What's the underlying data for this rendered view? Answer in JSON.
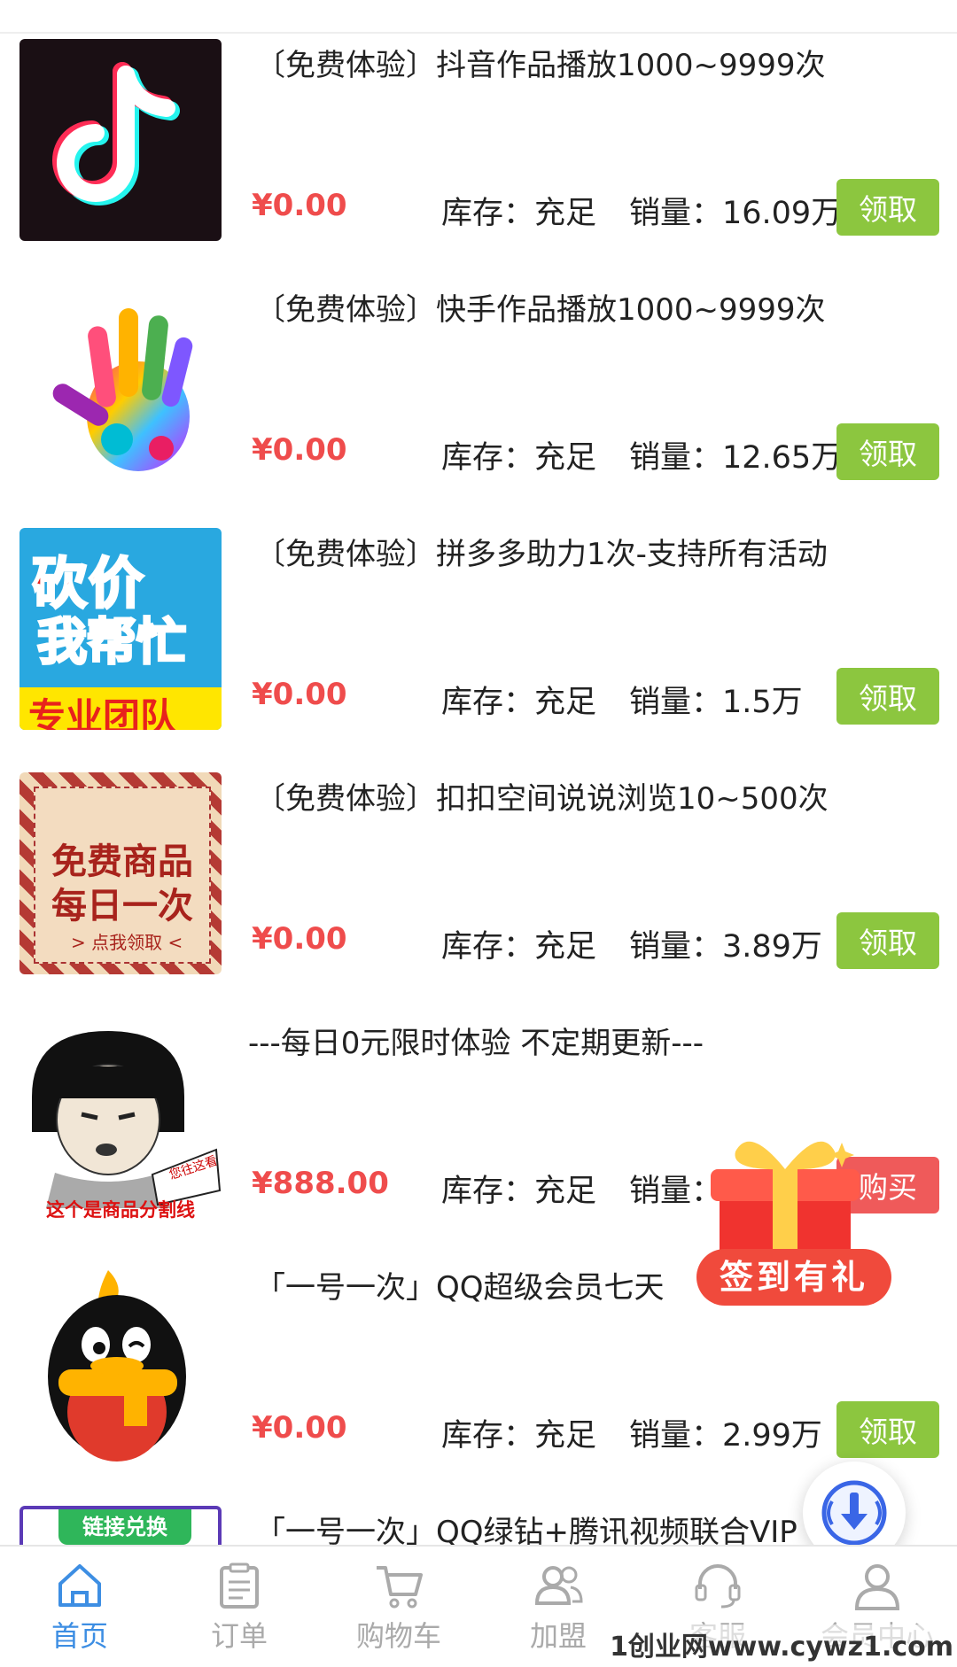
{
  "products": [
    {
      "title": "〔免费体验〕抖音作品播放1000~9999次",
      "price": "¥0.00",
      "stock": "库存：充足",
      "sales": "销量：16.09万",
      "button": "领取",
      "thumb": "douyin-logo"
    },
    {
      "title": "〔免费体验〕快手作品播放1000~9999次",
      "price": "¥0.00",
      "stock": "库存：充足",
      "sales": "销量：12.65万",
      "button": "领取",
      "thumb": "colorful-hand"
    },
    {
      "title": "〔免费体验〕拼多多助力1次-支持所有活动",
      "price": "¥0.00",
      "stock": "库存：充足",
      "sales": "销量：1.5万",
      "button": "领取",
      "thumb": "bargain-help"
    },
    {
      "title": "〔免费体验〕扣扣空间说说浏览10~500次",
      "price": "¥0.00",
      "stock": "库存：充足",
      "sales": "销量：3.89万",
      "button": "领取",
      "thumb": "free-product-daily"
    },
    {
      "title": "---每日0元限时体验 不定期更新---",
      "price": "¥888.00",
      "stock": "库存：充足",
      "sales": "销量：(",
      "button": "购买",
      "thumb": "meme-divider"
    },
    {
      "title": "「一号一次」QQ超级会员七天",
      "price": "¥0.00",
      "stock": "库存：充足",
      "sales": "销量：2.99万",
      "button": "领取",
      "thumb": "qq-penguin"
    },
    {
      "title": "「一号一次」QQ绿钻+腾讯视频联合VIP",
      "thumb": "link-exchange"
    }
  ],
  "thumb_text": {
    "bargain": [
      "砍价",
      "我帮忙",
      "专业团队"
    ],
    "free": [
      "免费商品",
      "每日一次",
      "> 点我领取 <"
    ],
    "meme_caption": "这个是商品分割线",
    "meme_tag": "您往这看",
    "link_exchange": "链接兑换"
  },
  "gift": {
    "label": "签到有礼"
  },
  "tabs": [
    {
      "label": "首页",
      "icon": "home-icon",
      "active": true
    },
    {
      "label": "订单",
      "icon": "order-icon",
      "active": false
    },
    {
      "label": "购物车",
      "icon": "cart-icon",
      "active": false
    },
    {
      "label": "加盟",
      "icon": "users-icon",
      "active": false
    },
    {
      "label": "客服",
      "icon": "headset-icon",
      "active": false
    },
    {
      "label": "会员中心",
      "icon": "user-icon",
      "active": false
    }
  ],
  "watermark": "1创业网www.cywz1.com",
  "colors": {
    "price": "#ef4c4c",
    "claim_button": "#8cc63f",
    "buy_button": "#ef5a5a",
    "tab_active": "#3d8ee3",
    "tab_inactive": "#aaaaaa"
  }
}
